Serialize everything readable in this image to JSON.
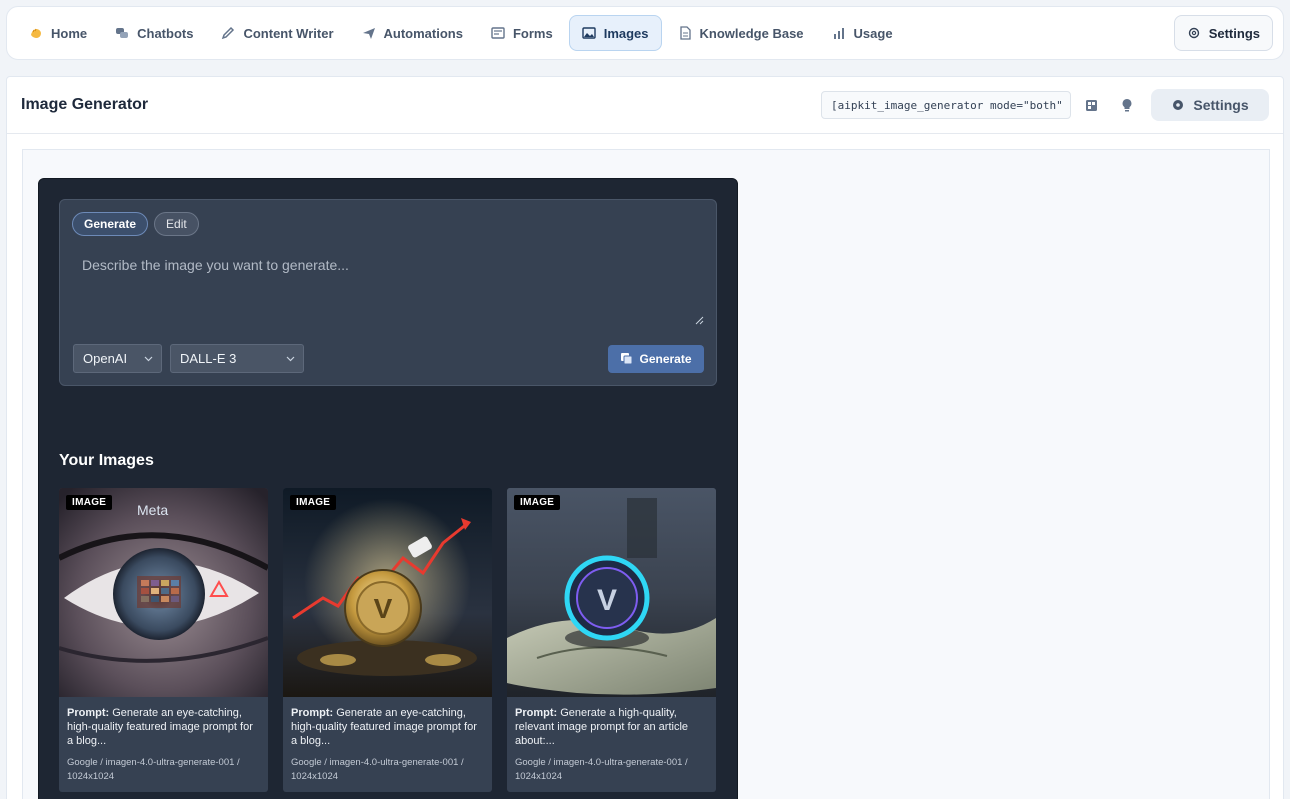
{
  "nav": {
    "items": [
      {
        "label": "Home",
        "icon": "hand-wave-icon"
      },
      {
        "label": "Chatbots",
        "icon": "chat-bubbles-icon"
      },
      {
        "label": "Content Writer",
        "icon": "pencil-icon"
      },
      {
        "label": "Automations",
        "icon": "plane-icon"
      },
      {
        "label": "Forms",
        "icon": "form-icon"
      },
      {
        "label": "Images",
        "icon": "image-icon"
      },
      {
        "label": "Knowledge Base",
        "icon": "document-icon"
      },
      {
        "label": "Usage",
        "icon": "bar-chart-icon"
      }
    ],
    "active": "Images",
    "settings_label": "Settings"
  },
  "header": {
    "title": "Image Generator",
    "shortcode": "[aipkit_image_generator mode=\"both\" ui_theme=\"dark\"]",
    "settings_label": "Settings"
  },
  "widget": {
    "tabs": [
      {
        "label": "Generate",
        "active": true
      },
      {
        "label": "Edit",
        "active": false
      }
    ],
    "prompt_placeholder": "Describe the image you want to generate...",
    "provider": "OpenAI",
    "model": "DALL-E 3",
    "generate_label": "Generate",
    "gallery_title": "Your Images",
    "prompt_prefix": "Prompt:",
    "images": [
      {
        "badge": "IMAGE",
        "prompt": "Generate an eye-catching, high-quality featured image prompt for a blog...",
        "meta": "Google / imagen-4.0-ultra-generate-001 / 1024x1024",
        "logo_text": "Meta"
      },
      {
        "badge": "IMAGE",
        "prompt": "Generate an eye-catching, high-quality featured image prompt for a blog...",
        "meta": "Google / imagen-4.0-ultra-generate-001 / 1024x1024"
      },
      {
        "badge": "IMAGE",
        "prompt": "Generate a high-quality, relevant image prompt for an article about:...",
        "meta": "Google / imagen-4.0-ultra-generate-001 / 1024x1024"
      }
    ]
  }
}
